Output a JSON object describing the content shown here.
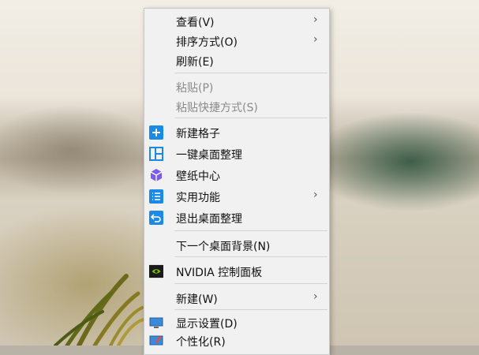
{
  "context_menu": {
    "items": [
      {
        "label": "查看(V)"
      },
      {
        "label": "排序方式(O)"
      },
      {
        "label": "刷新(E)"
      },
      {
        "label": "粘贴(P)"
      },
      {
        "label": "粘贴快捷方式(S)"
      },
      {
        "label": "新建格子",
        "icon": "plus-icon"
      },
      {
        "label": "一键桌面整理",
        "icon": "layout-icon"
      },
      {
        "label": "壁纸中心",
        "icon": "cube-icon"
      },
      {
        "label": "实用功能",
        "icon": "list-icon"
      },
      {
        "label": "退出桌面整理",
        "icon": "return-icon"
      },
      {
        "label": "下一个桌面背景(N)"
      },
      {
        "label": "NVIDIA 控制面板",
        "icon": "nvidia-icon"
      },
      {
        "label": "新建(W)"
      },
      {
        "label": "显示设置(D)",
        "icon": "monitor-icon"
      },
      {
        "label": "个性化(R)",
        "icon": "personalize-icon"
      }
    ],
    "submenu_arrow": "›"
  },
  "colors": {
    "menu_bg": "#f1f1f1",
    "accent_blue": "#1a8ae6",
    "purple": "#7b5cf0",
    "nvidia_green": "#76b900",
    "disabled_text": "#8a8a8a"
  }
}
